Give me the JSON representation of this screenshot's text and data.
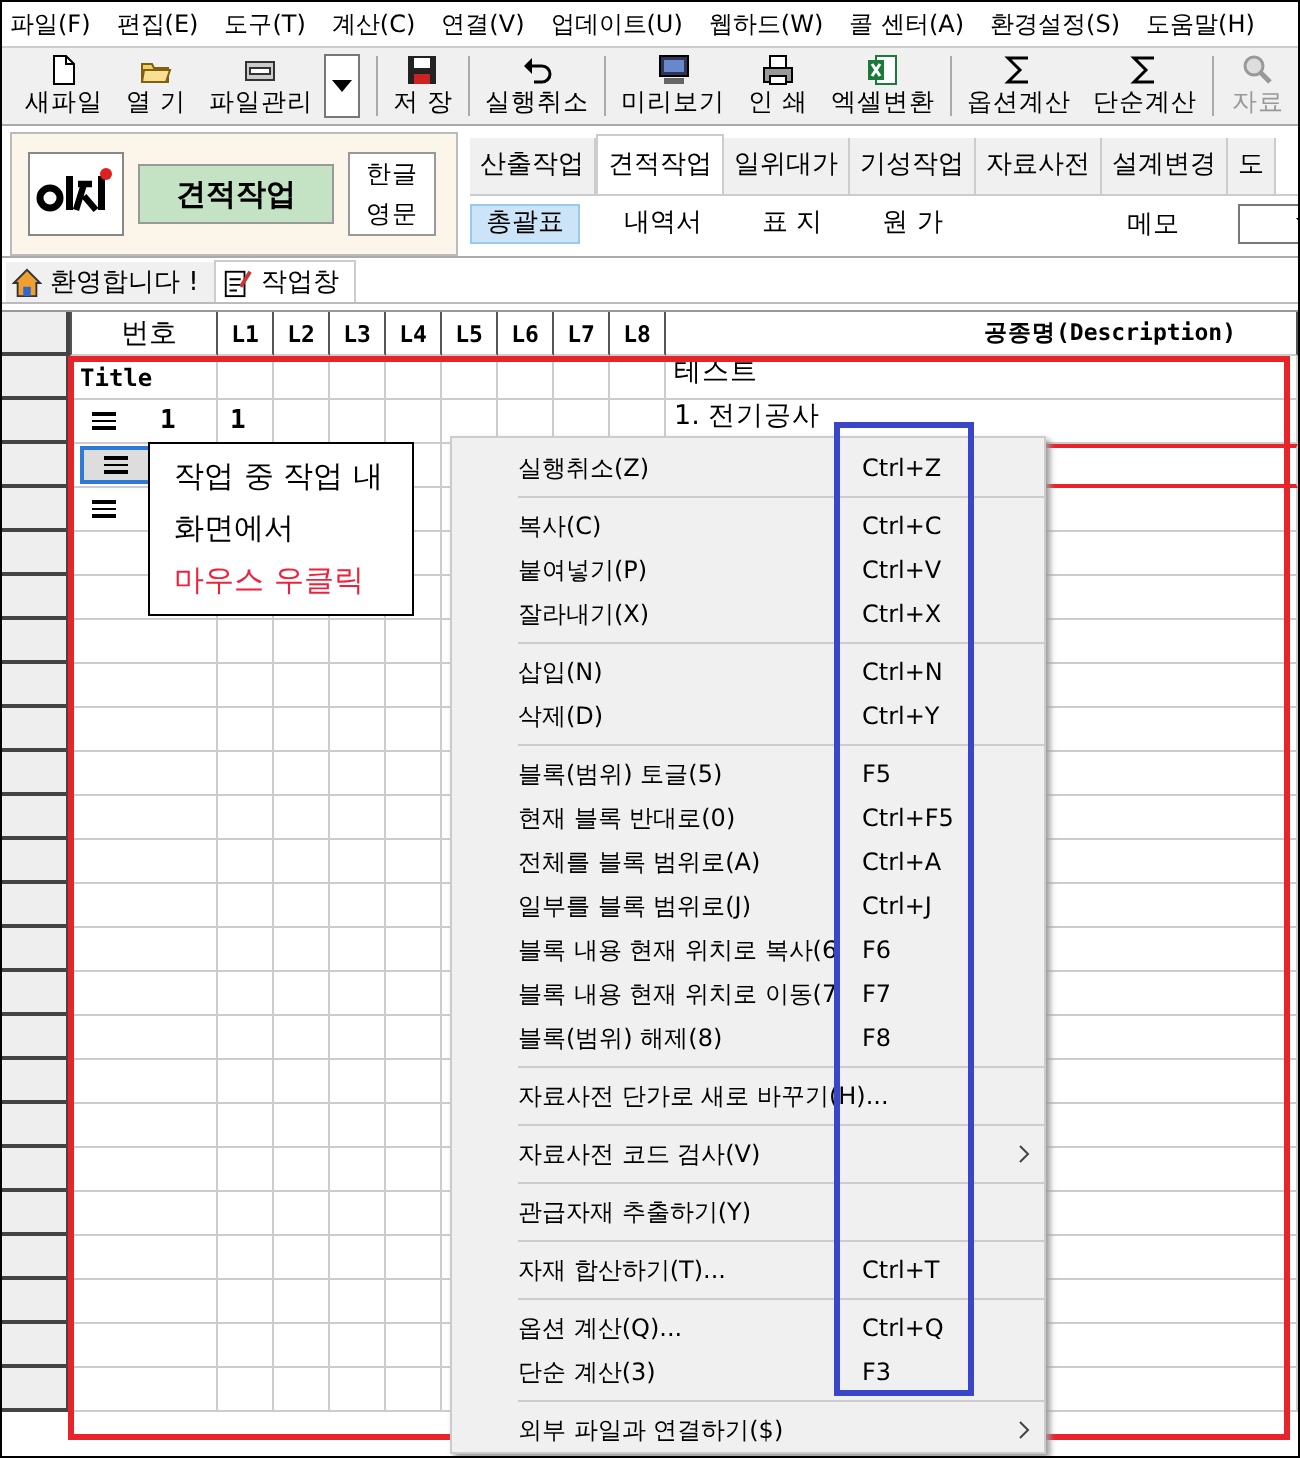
{
  "menubar": [
    "파일(F)",
    "편집(E)",
    "도구(T)",
    "계산(C)",
    "연결(V)",
    "업데이트(U)",
    "웹하드(W)",
    "콜 센터(A)",
    "환경설정(S)",
    "도움말(H)"
  ],
  "toolbar": [
    {
      "kind": "file",
      "label": "새파일"
    },
    {
      "kind": "folder",
      "label": "열 기"
    },
    {
      "kind": "manager",
      "label": "파일관리"
    },
    {
      "kind": "dropdown"
    },
    {
      "kind": "save",
      "label": "저 장"
    },
    {
      "kind": "undo",
      "label": "실행취소"
    },
    {
      "kind": "monitor",
      "label": "미리보기"
    },
    {
      "kind": "printer",
      "label": "인 쇄"
    },
    {
      "kind": "excel",
      "label": "엑셀변환"
    },
    {
      "kind": "sigma",
      "label": "옵션계산"
    },
    {
      "kind": "sigma",
      "label": "단순계산"
    },
    {
      "kind": "search",
      "label": "자료",
      "disabled": true
    }
  ],
  "mode_panel": {
    "mode_button": "견적작업",
    "lang_button": [
      "한글",
      "영문"
    ]
  },
  "tabs": [
    {
      "label": "산출작업",
      "selected": false
    },
    {
      "label": "견적작업",
      "selected": true
    },
    {
      "label": "일위대가",
      "selected": false
    },
    {
      "label": "기성작업",
      "selected": false
    },
    {
      "label": "자료사전",
      "selected": false
    },
    {
      "label": "설계변경",
      "selected": false
    },
    {
      "label": "도",
      "selected": false
    }
  ],
  "subtabs": [
    {
      "label": "총괄표",
      "selected": true
    },
    {
      "label": "내역서",
      "selected": false
    },
    {
      "label": "표 지",
      "selected": false
    },
    {
      "label": "원 가",
      "selected": false
    }
  ],
  "memo_label": "메모",
  "doc_tabs": [
    {
      "kind": "home",
      "label": "환영합니다 !",
      "selected": false
    },
    {
      "kind": "sheet",
      "label": "작업창",
      "selected": true
    }
  ],
  "table": {
    "columns": [
      "번호",
      "L1",
      "L2",
      "L3",
      "L4",
      "L5",
      "L6",
      "L7",
      "L8",
      "공종명(Description)"
    ],
    "rows": [
      {
        "kind": "title",
        "number": "Title",
        "description": "테스트",
        "selected": false
      },
      {
        "kind": "item",
        "number": "1",
        "l1": "1",
        "description": "1. 전기공사",
        "selected": false
      },
      {
        "kind": "item",
        "selected": true
      },
      {
        "kind": "item",
        "selected": false
      }
    ]
  },
  "callout": {
    "lines": [
      "작업 중 작업 내",
      "화면에서"
    ],
    "highlight": "마우스 우클릭"
  },
  "context_menu": [
    {
      "kind": "item",
      "label": "실행취소(Z)",
      "shortcut": "Ctrl+Z"
    },
    {
      "kind": "separator"
    },
    {
      "kind": "item",
      "label": "복사(C)",
      "shortcut": "Ctrl+C"
    },
    {
      "kind": "item",
      "label": "붙여넣기(P)",
      "shortcut": "Ctrl+V"
    },
    {
      "kind": "item",
      "label": "잘라내기(X)",
      "shortcut": "Ctrl+X"
    },
    {
      "kind": "separator"
    },
    {
      "kind": "item",
      "label": "삽입(N)",
      "shortcut": "Ctrl+N"
    },
    {
      "kind": "item",
      "label": "삭제(D)",
      "shortcut": "Ctrl+Y"
    },
    {
      "kind": "separator"
    },
    {
      "kind": "item",
      "label": "블록(범위) 토글(5)",
      "shortcut": "F5"
    },
    {
      "kind": "item",
      "label": "현재 블록 반대로(0)",
      "shortcut": "Ctrl+F5"
    },
    {
      "kind": "item",
      "label": "전체를 블록 범위로(A)",
      "shortcut": "Ctrl+A"
    },
    {
      "kind": "item",
      "label": "일부를 블록 범위로(J)",
      "shortcut": "Ctrl+J"
    },
    {
      "kind": "item",
      "label": "블록 내용 현재 위치로 복사(6",
      "shortcut": "F6"
    },
    {
      "kind": "item",
      "label": "블록 내용 현재 위치로 이동(7",
      "shortcut": "F7"
    },
    {
      "kind": "item",
      "label": "블록(범위) 해제(8)",
      "shortcut": "F8"
    },
    {
      "kind": "separator"
    },
    {
      "kind": "item",
      "label": "자료사전 단가로 새로 바꾸기(H)..."
    },
    {
      "kind": "separator"
    },
    {
      "kind": "submenu",
      "label": "자료사전 코드 검사(V)"
    },
    {
      "kind": "separator"
    },
    {
      "kind": "item",
      "label": "관급자재 추출하기(Y)"
    },
    {
      "kind": "separator"
    },
    {
      "kind": "item",
      "label": "자재 합산하기(T)...",
      "shortcut": "Ctrl+T"
    },
    {
      "kind": "separator"
    },
    {
      "kind": "item",
      "label": "옵션 계산(Q)...",
      "shortcut": "Ctrl+Q"
    },
    {
      "kind": "item",
      "label": "단순 계산(3)",
      "shortcut": "F3"
    },
    {
      "kind": "separator"
    },
    {
      "kind": "submenu",
      "label": "외부 파일과 연결하기($)"
    }
  ]
}
